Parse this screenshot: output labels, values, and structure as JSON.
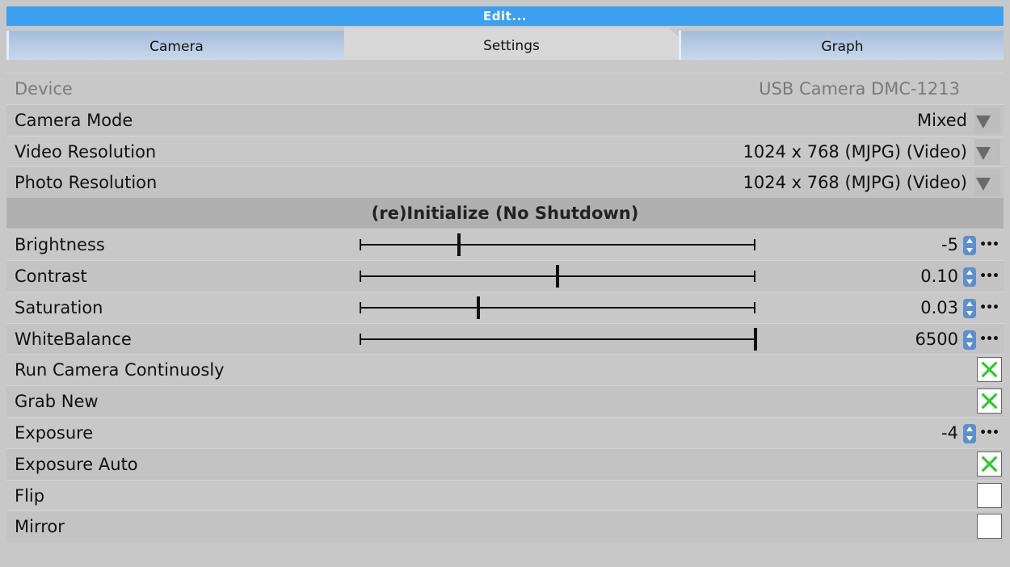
{
  "window": {
    "title": "Edit..."
  },
  "tabs": [
    {
      "label": "Camera"
    },
    {
      "label": "Settings"
    },
    {
      "label": "Graph"
    }
  ],
  "device": {
    "label": "Device",
    "value": "USB Camera DMC-1213"
  },
  "camera_mode": {
    "label": "Camera Mode",
    "value": "Mixed"
  },
  "video_resolution": {
    "label": "Video Resolution",
    "value": "1024 x 768 (MJPG) (Video)"
  },
  "photo_resolution": {
    "label": "Photo Resolution",
    "value": "1024 x 768 (MJPG) (Video)"
  },
  "init_button": {
    "label": "(re)Initialize (No Shutdown)"
  },
  "sliders": [
    {
      "label": "Brightness",
      "value": "-5",
      "fraction": 0.25
    },
    {
      "label": "Contrast",
      "value": "0.10",
      "fraction": 0.5
    },
    {
      "label": "Saturation",
      "value": "0.03",
      "fraction": 0.3
    },
    {
      "label": "WhiteBalance",
      "value": "6500",
      "fraction": 1.0
    }
  ],
  "run_continuously": {
    "label": "Run Camera Continuosly",
    "checked": true
  },
  "grab_new": {
    "label": "Grab New",
    "checked": true
  },
  "exposure": {
    "label": "Exposure",
    "value": "-4"
  },
  "exposure_auto": {
    "label": "Exposure Auto",
    "checked": true
  },
  "flip": {
    "label": "Flip",
    "checked": false
  },
  "mirror": {
    "label": "Mirror",
    "checked": false
  },
  "more_glyph": "•••",
  "colors": {
    "title_bar": "#3d9ff0",
    "tab": "#a4bddc",
    "check": "#22cc22"
  }
}
